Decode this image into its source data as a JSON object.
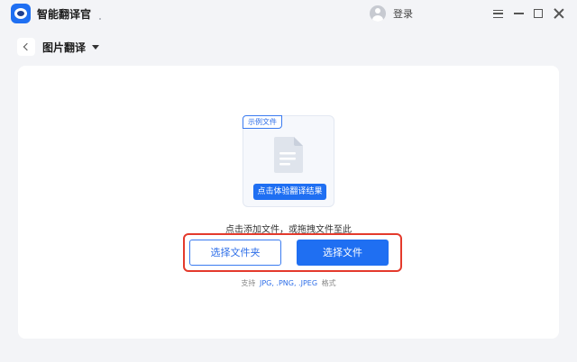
{
  "app": {
    "title": "智能翻译官",
    "brand_color": "#1f6ff2"
  },
  "titlebar": {
    "login_label": "登录",
    "icons": [
      "menu-icon",
      "minimize-icon",
      "maximize-icon",
      "close-icon"
    ]
  },
  "header": {
    "page_title": "图片翻译"
  },
  "sample": {
    "tag": "示例文件",
    "action": "点击体验翻译结果"
  },
  "upload": {
    "hint": "点击添加文件，或拖拽文件至此",
    "select_folder": "选择文件夹",
    "select_file": "选择文件",
    "highlight_color": "#e43a2c"
  },
  "formats": {
    "prefix": "支持",
    "list": "JPG, .PNG, .JPEG",
    "suffix": "格式"
  }
}
